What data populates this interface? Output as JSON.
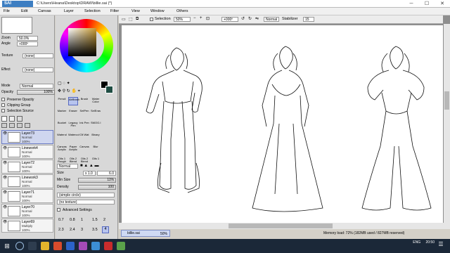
{
  "window": {
    "logo_top": "PaintTool",
    "logo_text": "SAI",
    "title": "C:\\Users\\Heana\\Desktop\\DRAW\\billie.sai (*)",
    "minimize": "─",
    "maximize": "☐",
    "close": "✕"
  },
  "menu": [
    "File",
    "Edit",
    "Canvas",
    "Layer",
    "Selection",
    "Filter",
    "View",
    "Window",
    "Others"
  ],
  "navigator": {
    "zoom_label": "Zoom",
    "zoom_value": "50.0%",
    "angle_label": "Angle",
    "angle_value": "+000º"
  },
  "layer_panel": {
    "texture_label": "Texture",
    "texture_value": "(none)",
    "effect_label": "Effect",
    "effect_value": "(none)",
    "mode_label": "Mode",
    "mode_value": "Normal",
    "opacity_label": "Opacity",
    "opacity_value": "100%",
    "preserve_opacity": "Preserve Opacity",
    "clipping_group": "Clipping Group",
    "selection_source": "Selection Source",
    "layers": [
      {
        "name": "Layer73",
        "mode": "Normal",
        "opacity": "100%",
        "selected": true
      },
      {
        "name": "Linework4",
        "mode": "Normal",
        "opacity": "100%",
        "selected": false
      },
      {
        "name": "Layer72",
        "mode": "Normal",
        "opacity": "100%",
        "selected": false
      },
      {
        "name": "Linework3",
        "mode": "Normal",
        "opacity": "100%",
        "selected": false
      },
      {
        "name": "Layer71",
        "mode": "Normal",
        "opacity": "100%",
        "selected": false
      },
      {
        "name": "Layer70",
        "mode": "Normal",
        "opacity": "100%",
        "selected": false
      },
      {
        "name": "Layer69",
        "mode": "Multiply",
        "opacity": "100%",
        "selected": false
      }
    ]
  },
  "tools": {
    "items": [
      {
        "label": "Pencil",
        "selected": false
      },
      {
        "label": "AirBrush",
        "selected": true
      },
      {
        "label": "Brush",
        "selected": false
      },
      {
        "label": "Water Color",
        "selected": false
      },
      {
        "label": "Marker",
        "selected": false
      },
      {
        "label": "Eraser",
        "selected": false
      },
      {
        "label": "SelPen",
        "selected": false
      },
      {
        "label": "SelEras",
        "selected": false
      },
      {
        "label": "Bucket",
        "selected": false
      },
      {
        "label": "Legacy Pen",
        "selected": false
      },
      {
        "label": "Ink Pen",
        "selected": false
      },
      {
        "label": "SMOG.I",
        "selected": false
      },
      {
        "label": "Waterol",
        "selected": false
      },
      {
        "label": "Watercol",
        "selected": false
      },
      {
        "label": "Oil Wat",
        "selected": false
      },
      {
        "label": "Binary",
        "selected": false
      },
      {
        "label": "Canvas Acrylic",
        "selected": false
      },
      {
        "label": "Paper Acrylic",
        "selected": false
      },
      {
        "label": "Canvas",
        "selected": false
      },
      {
        "label": "Blur",
        "selected": false
      },
      {
        "label": "Oils 1 Rough",
        "selected": false
      },
      {
        "label": "Oils 2 Blend",
        "selected": false
      },
      {
        "label": "Oils 2 Blend",
        "selected": false
      },
      {
        "label": "Oils 1",
        "selected": false
      }
    ],
    "blend_mode": "Normal",
    "size_label": "Size",
    "size_mult": "x 1.0",
    "size_value": "6.0",
    "min_size_label": "Min Size",
    "min_size_value": "11%",
    "density_label": "Density",
    "density_value": "100",
    "shape": "(simple circle)",
    "texture": "(no texture)",
    "advanced": "Advanced Settings",
    "presets": [
      "0.7",
      "0.8",
      "1",
      "1.5",
      "2",
      "2.3",
      "2.4",
      "3",
      "3.5",
      "4"
    ]
  },
  "canvas_toolbar": {
    "selection": "Selection",
    "zoom": "50%",
    "angle": "+000º",
    "mode": "Normal",
    "stabilizer_label": "Stabilizer",
    "stabilizer_value": "15"
  },
  "status": {
    "file_name": "billie.sai",
    "file_zoom": "50%",
    "memory": "Memory load: 72% (182MB used / 827MB reserved)"
  },
  "tray": {
    "lang": "ENG",
    "time": "20:50"
  }
}
